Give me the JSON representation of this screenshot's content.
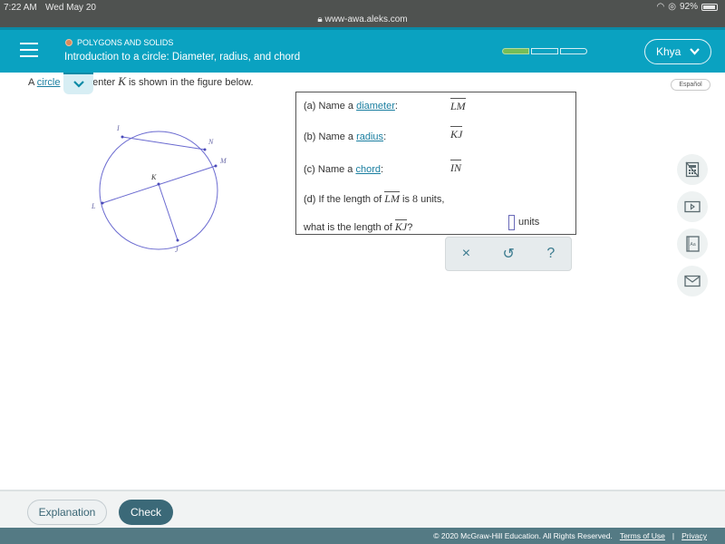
{
  "status_bar": {
    "time": "7:22 AM",
    "date": "Wed May 20",
    "url": "www-awa.aleks.com",
    "battery": "92%"
  },
  "header": {
    "topic": "POLYGONS AND SOLIDS",
    "lesson_title": "Introduction to a circle: Diameter, radius, and chord",
    "progress": {
      "filled_segments": 1,
      "total_segments": 3
    },
    "user_name": "Khya",
    "colors": {
      "header_bg": "#0aa2c1",
      "progress_fill": "#76bd57",
      "topic_dot": "#d98a5a"
    }
  },
  "content": {
    "intro_prefix": "A",
    "intro_link": "circle",
    "intro_mid": "center",
    "intro_var": "K",
    "intro_suffix": "is shown in the figure below.",
    "espanol_label": "Español",
    "figure": {
      "labels": {
        "I": "I",
        "N": "N",
        "M": "M",
        "K": "K",
        "L": "L",
        "J": "J"
      }
    },
    "questions": {
      "a_prefix": "(a) Name a",
      "a_link": "diameter",
      "a_answer": "LM",
      "b_prefix": "(b) Name a",
      "b_link": "radius",
      "b_answer": "KJ",
      "c_prefix": "(c) Name a",
      "c_link": "chord",
      "c_answer": "IN",
      "d_prefix": "(d) If the length of",
      "d_seg": "LM",
      "d_is": "is",
      "d_value": "8",
      "d_suffix": "units,",
      "d2_prefix": "what is the length of",
      "d2_seg": "KJ",
      "d2_q": "?",
      "answer_value": "",
      "units_label": "units",
      "colon": ":"
    },
    "toolbar": {
      "clear": "×",
      "undo": "↺",
      "help": "?"
    }
  },
  "side_tools": [
    "calculator-icon",
    "video-icon",
    "dictionary-icon",
    "message-icon"
  ],
  "footer": {
    "explanation_label": "Explanation",
    "check_label": "Check",
    "copyright": "© 2020 McGraw-Hill Education. All Rights Reserved.",
    "terms_label": "Terms of Use",
    "separator": "|",
    "privacy_label": "Privacy"
  }
}
